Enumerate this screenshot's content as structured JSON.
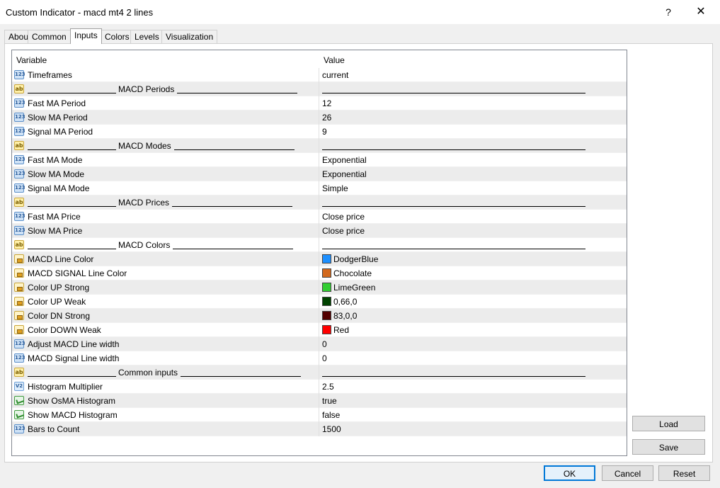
{
  "window": {
    "title": "Custom Indicator - macd mt4 2 lines",
    "help_glyph": "?",
    "close_glyph": "✕"
  },
  "tabs": [
    {
      "label": "About",
      "active": false
    },
    {
      "label": "Common",
      "active": false
    },
    {
      "label": "Inputs",
      "active": true
    },
    {
      "label": "Colors",
      "active": false
    },
    {
      "label": "Levels",
      "active": false
    },
    {
      "label": "Visualization",
      "active": false
    }
  ],
  "grid": {
    "col_variable": "Variable",
    "col_value": "Value",
    "rows": [
      {
        "type": "int",
        "icon": "int-param-icon",
        "variable": "Timeframes",
        "value": "current"
      },
      {
        "type": "separator",
        "icon": "string-param-icon",
        "variable": "MACD Periods",
        "value": ""
      },
      {
        "type": "int",
        "icon": "int-param-icon",
        "variable": "Fast MA Period",
        "value": "12"
      },
      {
        "type": "int",
        "icon": "int-param-icon",
        "variable": "Slow MA Period",
        "value": "26"
      },
      {
        "type": "int",
        "icon": "int-param-icon",
        "variable": "Signal MA Period",
        "value": "9"
      },
      {
        "type": "separator",
        "icon": "string-param-icon",
        "variable": "MACD Modes",
        "value": ""
      },
      {
        "type": "int",
        "icon": "int-param-icon",
        "variable": "Fast MA Mode",
        "value": "Exponential"
      },
      {
        "type": "int",
        "icon": "int-param-icon",
        "variable": "Slow MA Mode",
        "value": "Exponential"
      },
      {
        "type": "int",
        "icon": "int-param-icon",
        "variable": "Signal MA Mode",
        "value": "Simple"
      },
      {
        "type": "separator",
        "icon": "string-param-icon",
        "variable": "MACD Prices",
        "value": ""
      },
      {
        "type": "int",
        "icon": "int-param-icon",
        "variable": "Fast MA Price",
        "value": "Close price"
      },
      {
        "type": "int",
        "icon": "int-param-icon",
        "variable": "Slow MA Price",
        "value": "Close price"
      },
      {
        "type": "separator",
        "icon": "string-param-icon",
        "variable": "MACD Colors",
        "value": ""
      },
      {
        "type": "color",
        "icon": "color-param-icon",
        "variable": "MACD Line Color",
        "value": "DodgerBlue",
        "swatch": "#1e90ff"
      },
      {
        "type": "color",
        "icon": "color-param-icon",
        "variable": "MACD SIGNAL Line Color",
        "value": "Chocolate",
        "swatch": "#d2691e"
      },
      {
        "type": "color",
        "icon": "color-param-icon",
        "variable": "Color UP Strong",
        "value": "LimeGreen",
        "swatch": "#32cd32"
      },
      {
        "type": "color",
        "icon": "color-param-icon",
        "variable": "Color UP Weak",
        "value": "0,66,0",
        "swatch": "#004200"
      },
      {
        "type": "color",
        "icon": "color-param-icon",
        "variable": "Color DN Strong",
        "value": "83,0,0",
        "swatch": "#530000"
      },
      {
        "type": "color",
        "icon": "color-param-icon",
        "variable": "Color DOWN Weak",
        "value": "Red",
        "swatch": "#ff0000"
      },
      {
        "type": "int",
        "icon": "int-param-icon",
        "variable": "Adjust MACD Line width",
        "value": "0"
      },
      {
        "type": "int",
        "icon": "int-param-icon",
        "variable": "MACD Signal Line width",
        "value": "0"
      },
      {
        "type": "separator",
        "icon": "string-param-icon",
        "variable": "Common inputs",
        "value": ""
      },
      {
        "type": "double",
        "icon": "double-param-icon",
        "variable": "Histogram Multiplier",
        "value": "2.5"
      },
      {
        "type": "bool",
        "icon": "bool-param-icon",
        "variable": "Show OsMA Histogram",
        "value": "true"
      },
      {
        "type": "bool",
        "icon": "bool-param-icon",
        "variable": "Show MACD Histogram",
        "value": "false"
      },
      {
        "type": "int",
        "icon": "int-param-icon",
        "variable": "Bars to Count",
        "value": "1500"
      }
    ]
  },
  "side_buttons": {
    "load": "Load",
    "save": "Save"
  },
  "footer_buttons": {
    "ok": "OK",
    "cancel": "Cancel",
    "reset": "Reset"
  },
  "colors": {
    "ok_border": "#0078d7"
  }
}
